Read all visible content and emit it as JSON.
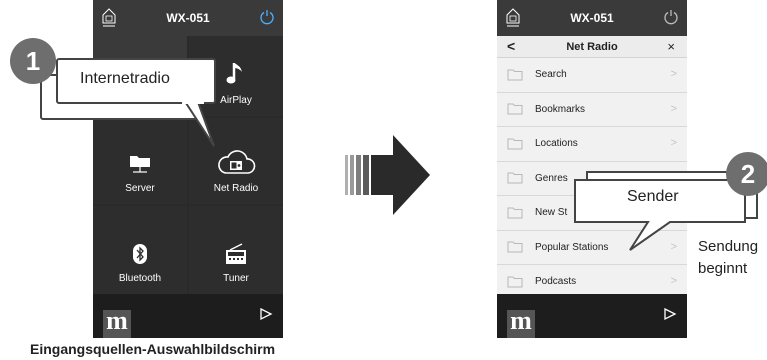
{
  "left_phone": {
    "title": "WX-051",
    "tiles": [
      {
        "label": "",
        "icon": "speaker-image"
      },
      {
        "label": "AirPlay",
        "icon": "music-note-icon"
      },
      {
        "label": "Server",
        "icon": "folder-server-icon"
      },
      {
        "label": "Net Radio",
        "icon": "cloud-radio-icon"
      },
      {
        "label": "Bluetooth",
        "icon": "bluetooth-icon"
      },
      {
        "label": "Tuner",
        "icon": "radio-icon"
      }
    ],
    "callout": {
      "number": "1",
      "text": "Internetradio"
    },
    "caption": "Eingangsquellen-Auswahlbildschirm"
  },
  "right_phone": {
    "title": "WX-051",
    "nav_title": "Net Radio",
    "back": "<",
    "close": "×",
    "items": [
      "Search",
      "Bookmarks",
      "Locations",
      "Genres",
      "New Stations",
      "Popular Stations",
      "Podcasts"
    ],
    "visible_items": [
      "Search",
      "Bookmarks",
      "Locations",
      "Genres",
      "New St",
      "Popular Stations",
      "Podcasts"
    ],
    "callout": {
      "number": "2",
      "text": "Sender"
    },
    "note_line1": "Sendung",
    "note_line2": "beginnt"
  },
  "colors": {
    "tile_bg": "#2d2d2d",
    "list_bg": "#f1f1f1",
    "badge": "#6e6e6e"
  }
}
